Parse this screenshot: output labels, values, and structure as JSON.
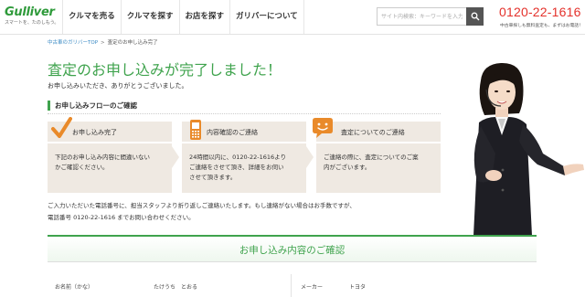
{
  "header": {
    "logo_text": "Gulliver",
    "logo_tagline": "スマートを、たのしもう。",
    "nav": [
      "クルマを売る",
      "クルマを探す",
      "お店を探す",
      "ガリバーについて"
    ],
    "search_placeholder": "サイト内検索：キーワードを入力",
    "phone": "0120-22-1616",
    "phone_note": "中古車探しも無料査定も、まずはお電話！"
  },
  "breadcrumb": {
    "home": "中古車のガリバーTOP",
    "separator": ">",
    "current": "査定のお申し込み完了"
  },
  "page_title": "査定のお申し込みが完了しました！",
  "intro": "お申し込みいただき、ありがとうございました。",
  "flow_heading": "お申し込みフローのご確認",
  "flow": [
    {
      "icon": "check-icon",
      "title": "お申し込み完了",
      "body": [
        "下記のお申し込み内容に間違いない",
        "かご確認ください。"
      ]
    },
    {
      "icon": "mobile-phone-icon",
      "title": "内容確認のご連絡",
      "body": [
        "24時間以内に、0120-22-1616より",
        "ご連絡をさせて頂き、詳細をお伺い",
        "させて頂きます。"
      ]
    },
    {
      "icon": "speech-bubble-icon",
      "title": "査定についてのご連絡",
      "body": [
        "ご連絡の際に、査定についてのご案",
        "内がございます。"
      ]
    }
  ],
  "notes": [
    "ご入力いただいた電話番号に、担当スタッフより折り返しご連絡いたします。もし連絡がない場合はお手数ですが、",
    "電話番号 0120-22-1616 までお問い合わせください。"
  ],
  "confirm_title": "お申し込み内容のご確認",
  "table": {
    "name_label": "お名前（かな）",
    "name_value": "たけうち　とおる",
    "maker_label": "メーカー",
    "maker_value": "トヨタ"
  },
  "colors": {
    "brand_green": "#3fa34d",
    "phone_red": "#e4312b",
    "flow_bg": "#efe9e2",
    "accent_orange": "#e98a2a"
  }
}
